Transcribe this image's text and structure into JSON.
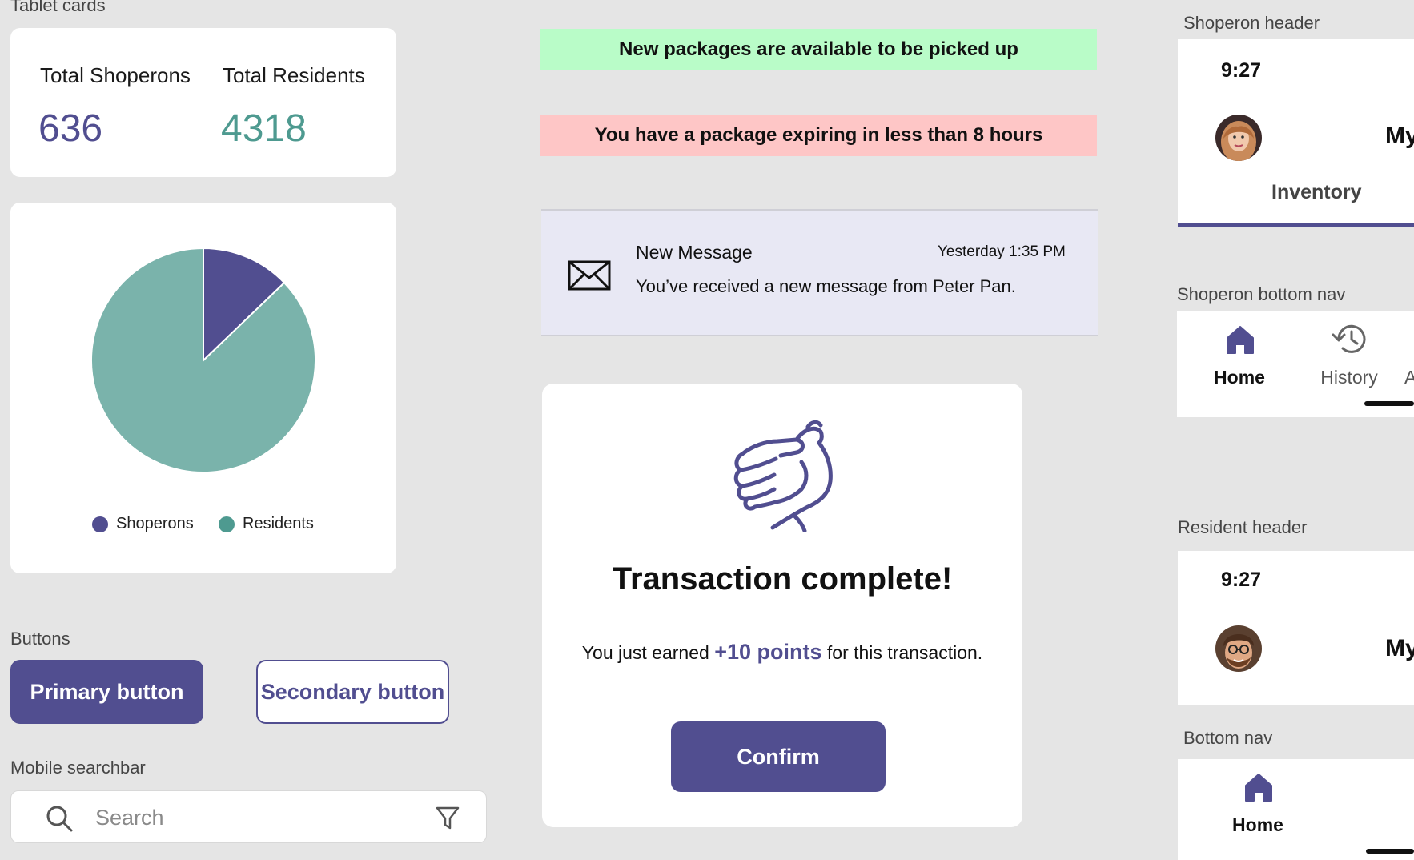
{
  "sections": {
    "tablet_cards": "Tablet cards",
    "buttons": "Buttons",
    "mobile_searchbar": "Mobile searchbar",
    "shoperon_header": "Shoperon header",
    "shoperon_bottom_nav": "Shoperon bottom nav",
    "resident_header": "Resident header",
    "bottom_nav": "Bottom nav"
  },
  "stats": {
    "shoperons_label": "Total Shoperons",
    "shoperons_value": "636",
    "residents_label": "Total Residents",
    "residents_value": "4318"
  },
  "chart_data": {
    "type": "pie",
    "labels": [
      "Shoperons",
      "Residents"
    ],
    "values": [
      636,
      4318
    ],
    "colors": [
      "#514e90",
      "#7ab3ab"
    ],
    "legend": "bottom"
  },
  "legend": {
    "shoperons": "Shoperons",
    "residents": "Residents"
  },
  "buttons": {
    "primary": "Primary button",
    "secondary": "Secondary button"
  },
  "search": {
    "placeholder": "Search"
  },
  "banners": {
    "success": "New packages are available to be picked up",
    "warning": "You have a package expiring in less than 8 hours"
  },
  "message": {
    "title": "New Message",
    "time": "Yesterday 1:35 PM",
    "body": "You’ve received a new message from Peter Pan."
  },
  "modal": {
    "title": "Transaction complete!",
    "body_prefix": "You just earned ",
    "points": "+10 points",
    "body_suffix": " for this transaction.",
    "confirm": "Confirm"
  },
  "shoperon_header": {
    "time": "9:27",
    "title_partial": "My",
    "tab": "Inventory"
  },
  "shoperon_nav": {
    "home": "Home",
    "history": "History",
    "partial": "A"
  },
  "resident_header": {
    "time": "9:27",
    "title_partial": "My"
  },
  "bottom_nav": {
    "home": "Home"
  },
  "colors": {
    "brand": "#514e90",
    "teal": "#7ab3ab",
    "teal_text": "#4e9a90",
    "success_bg": "#b9fcc8",
    "warning_bg": "#fec6c6",
    "message_bg": "#e8e8f4"
  }
}
